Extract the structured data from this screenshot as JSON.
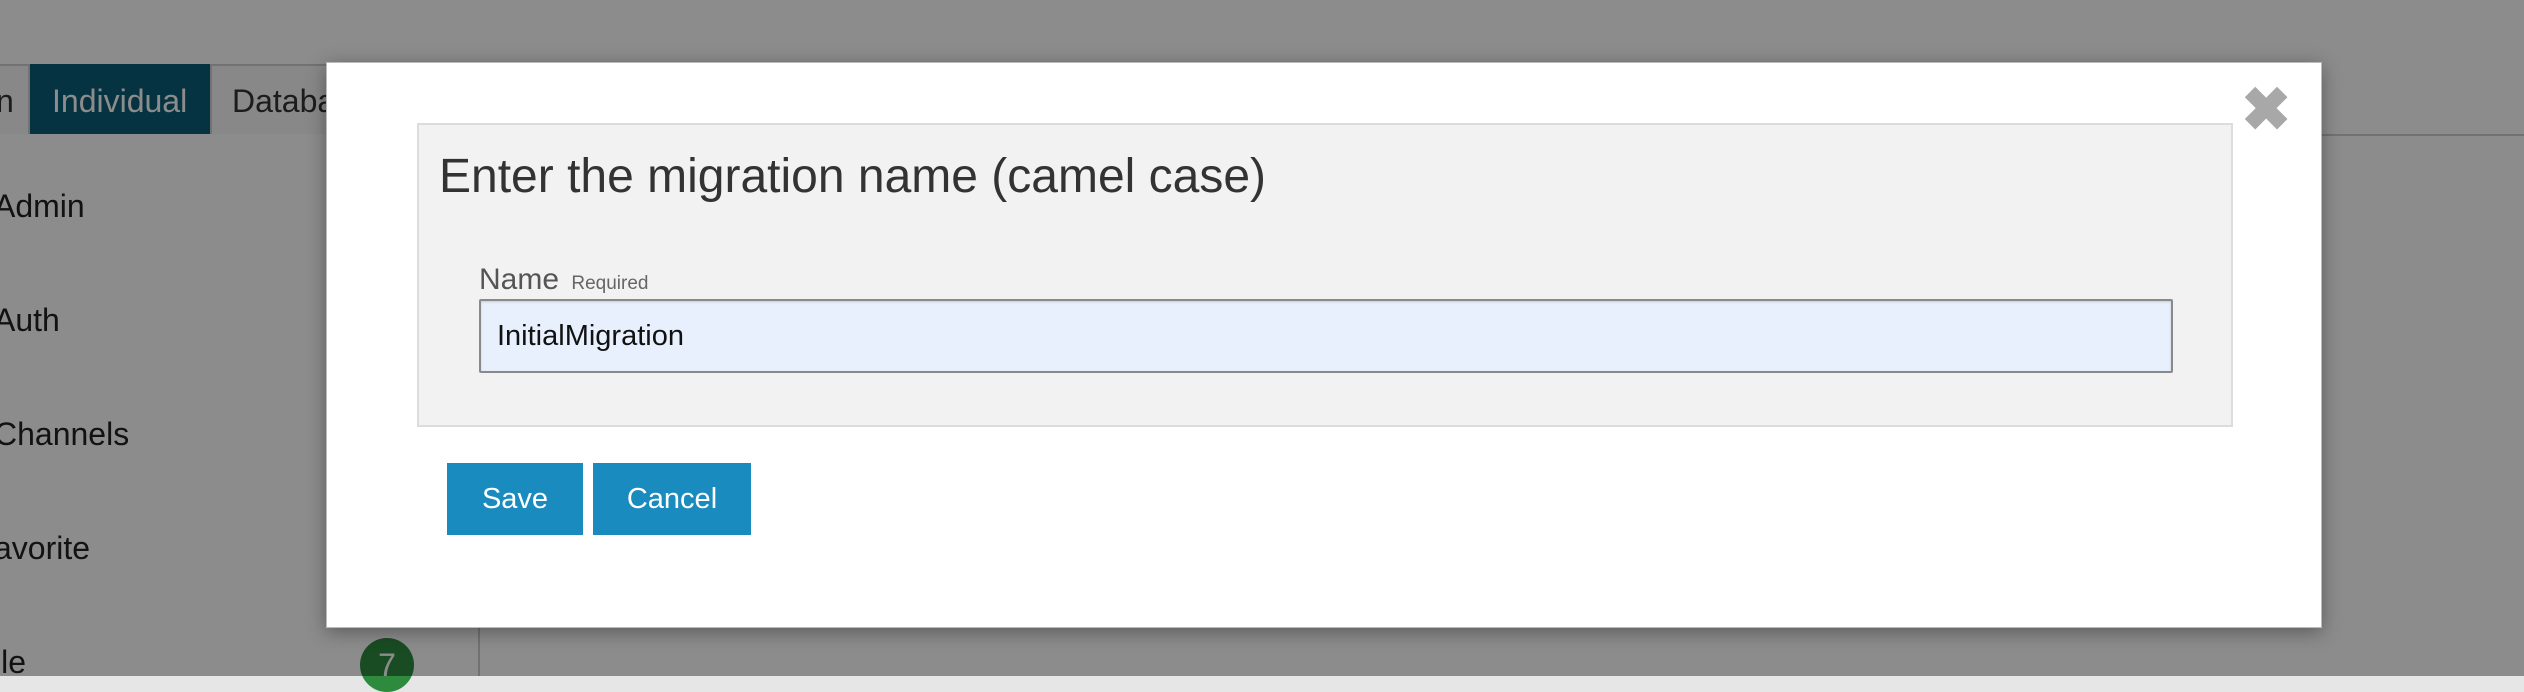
{
  "tabs": [
    {
      "label": "n"
    },
    {
      "label": "Individual"
    },
    {
      "label": "Databa"
    }
  ],
  "sidebar": {
    "items": [
      {
        "label": "Admin"
      },
      {
        "label": "Auth"
      },
      {
        "label": "Channels"
      },
      {
        "label": "avorite"
      },
      {
        "label": "ile",
        "badge": "7"
      }
    ]
  },
  "modal": {
    "title": "Enter the migration name (camel case)",
    "close_icon": "close-icon",
    "field": {
      "label": "Name",
      "required": "Required",
      "value": "InitialMigration"
    },
    "buttons": {
      "save": "Save",
      "cancel": "Cancel"
    }
  },
  "colors": {
    "primary_button": "#1a8bbf",
    "active_tab": "#0b5d78",
    "badge": "#2e8b3e",
    "input_bg": "#e8f0fe"
  }
}
